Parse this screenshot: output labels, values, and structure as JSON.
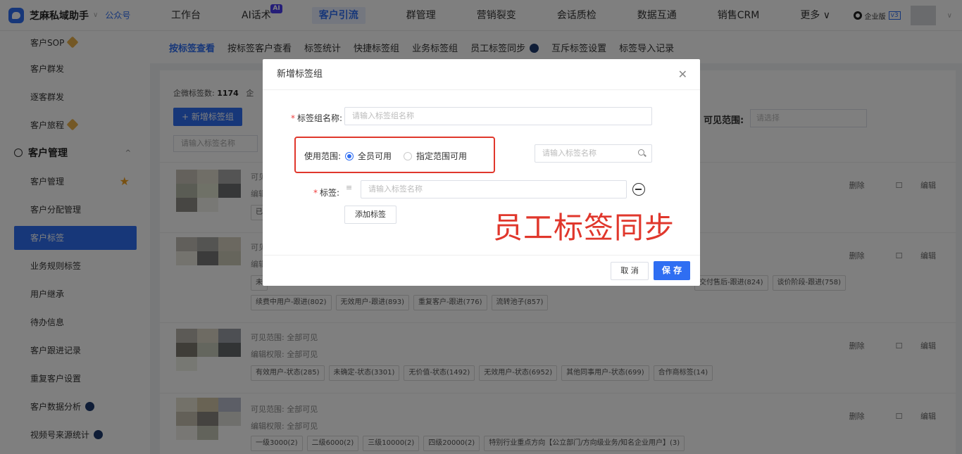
{
  "brand": {
    "name": "芝麻私域助手",
    "link": "公众号"
  },
  "nav": [
    {
      "label": "工作台"
    },
    {
      "label": "AI话术",
      "badge": "AI"
    },
    {
      "label": "客户引流",
      "active": true
    },
    {
      "label": "群管理"
    },
    {
      "label": "营销裂变"
    },
    {
      "label": "会话质检"
    },
    {
      "label": "数据互通"
    },
    {
      "label": "销售CRM"
    },
    {
      "label": "更多 ∨"
    }
  ],
  "top_right": {
    "edition": "企业版",
    "version": "v3"
  },
  "sidebar": {
    "items_top": [
      "客户SOP",
      "客户群发",
      "逐客群发",
      "客户旅程"
    ],
    "group": "客户管理",
    "items": [
      "客户管理",
      "客户分配管理",
      "客户标签",
      "业务规则标签",
      "用户继承",
      "待办信息",
      "客户跟进记录",
      "重复客户设置",
      "客户数据分析",
      "视频号来源统计"
    ]
  },
  "subtabs": [
    "按标签查看",
    "按标签客户查看",
    "标签统计",
    "快捷标签组",
    "业务标签组",
    "员工标签同步",
    "互斥标签设置",
    "标签导入记录"
  ],
  "main": {
    "stats_label": "企微标签数:",
    "stats_value": "1174",
    "stats_suffix": "企",
    "new_group_btn": "+ 新增标签组",
    "search_placeholder": "请输入标签名称",
    "visible_label": "可见范围:",
    "visible_placeholder": "请选择",
    "row_delete": "删除",
    "row_edit": "编辑",
    "groups": [
      {
        "visible": "可见",
        "edit": "编辑",
        "tags": [
          "已"
        ]
      },
      {
        "visible": "可见",
        "edit": "编辑",
        "tags": [
          "未",
          "交付售后-跟进(824)",
          "谈价阶段-跟进(758)",
          "续费中用户-跟进(802)",
          "无效用户-跟进(893)",
          "重复客户-跟进(776)",
          "流转池子(857)"
        ]
      },
      {
        "visible": "可见范围:  全部可见",
        "edit": "编辑权限:  全部可见",
        "tags": [
          "有效用户-状态(285)",
          "未确定-状态(3301)",
          "无价值-状态(1492)",
          "无效用户-状态(6952)",
          "其他同事用户-状态(699)",
          "合作商标签(14)"
        ]
      },
      {
        "visible": "可见范围:  全部可见",
        "edit": "编辑权限:  全部可见",
        "tags": [
          "一级3000(2)",
          "二级6000(2)",
          "三级10000(2)",
          "四级20000(2)",
          "特别行业重点方向【公立部门/方向级业务/知名企业用户】(3)"
        ]
      }
    ]
  },
  "dialog": {
    "title": "新增标签组",
    "name_label": "标签组名称:",
    "name_placeholder": "请输入标签组名称",
    "scope_label": "使用范围:",
    "scope_all": "全员可用",
    "scope_custom": "指定范围可用",
    "search_placeholder": "请输入标签名称",
    "tag_label": "标签:",
    "tag_placeholder": "请输入标签名称",
    "add_tag": "添加标签",
    "cancel": "取 消",
    "save": "保 存",
    "annotation": "员工标签同步"
  }
}
